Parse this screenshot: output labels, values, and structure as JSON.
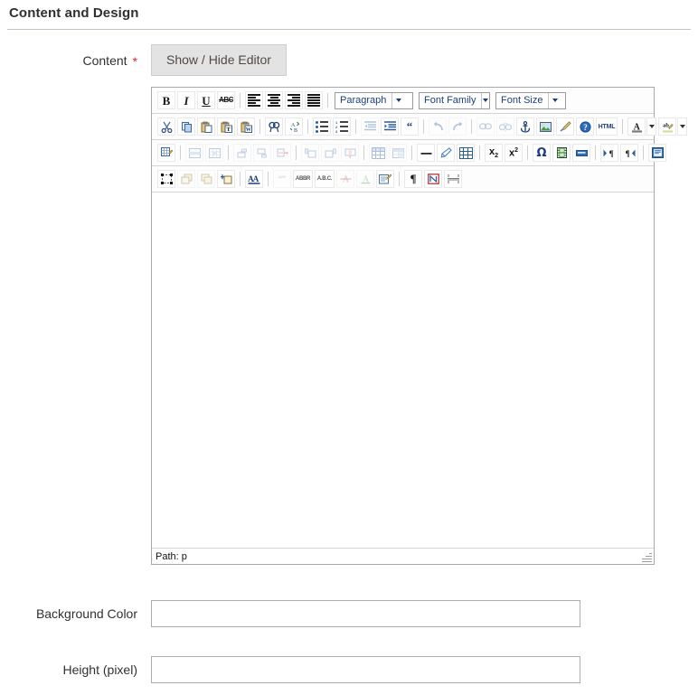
{
  "section": {
    "title": "Content and Design"
  },
  "fields": {
    "content": {
      "label": "Content",
      "required_marker": "*",
      "toggle_button": "Show / Hide Editor"
    },
    "background_color": {
      "label": "Background Color",
      "value": "",
      "placeholder": ""
    },
    "height_pixel": {
      "label": "Height (pixel)",
      "value": "",
      "placeholder": ""
    }
  },
  "editor": {
    "status_bar": "Path: p",
    "body_text": "",
    "selects": {
      "paragraph": "Paragraph",
      "font_family": "Font Family",
      "font_size": "Font Size"
    },
    "toolbar_rows": [
      {
        "name": "row-1",
        "items": [
          {
            "icon": "bold-icon",
            "label": "B"
          },
          {
            "icon": "italic-icon",
            "label": "I"
          },
          {
            "icon": "underline-icon",
            "label": "U"
          },
          {
            "icon": "strikethrough-icon",
            "label": "ABC"
          },
          {
            "icon": "separator"
          },
          {
            "icon": "align-left-icon",
            "label": ""
          },
          {
            "icon": "align-center-icon",
            "label": ""
          },
          {
            "icon": "align-right-icon",
            "label": ""
          },
          {
            "icon": "align-justify-icon",
            "label": ""
          },
          {
            "icon": "separator"
          },
          {
            "icon": "paragraph-format-select",
            "label": "Paragraph"
          },
          {
            "icon": "font-family-select",
            "label": "Font Family"
          },
          {
            "icon": "font-size-select",
            "label": "Font Size"
          }
        ]
      },
      {
        "name": "row-2",
        "items": [
          {
            "icon": "cut-icon",
            "label": ""
          },
          {
            "icon": "copy-icon",
            "label": ""
          },
          {
            "icon": "paste-icon",
            "label": ""
          },
          {
            "icon": "paste-as-text-icon",
            "label": ""
          },
          {
            "icon": "paste-from-word-icon",
            "label": ""
          },
          {
            "icon": "separator"
          },
          {
            "icon": "find-icon",
            "label": ""
          },
          {
            "icon": "find-replace-icon",
            "label": ""
          },
          {
            "icon": "separator"
          },
          {
            "icon": "bullet-list-icon",
            "label": ""
          },
          {
            "icon": "numbered-list-icon",
            "label": ""
          },
          {
            "icon": "separator"
          },
          {
            "icon": "outdent-icon",
            "label": ""
          },
          {
            "icon": "indent-icon",
            "label": ""
          },
          {
            "icon": "blockquote-icon",
            "label": ""
          },
          {
            "icon": "separator"
          },
          {
            "icon": "undo-icon",
            "label": ""
          },
          {
            "icon": "redo-icon",
            "label": ""
          },
          {
            "icon": "separator"
          },
          {
            "icon": "insert-link-icon",
            "label": ""
          },
          {
            "icon": "unlink-icon",
            "label": ""
          },
          {
            "icon": "anchor-icon",
            "label": ""
          },
          {
            "icon": "insert-image-icon",
            "label": ""
          },
          {
            "icon": "cleanup-icon",
            "label": ""
          },
          {
            "icon": "help-icon",
            "label": ""
          },
          {
            "icon": "html-source-icon",
            "label": "HTML"
          },
          {
            "icon": "separator"
          },
          {
            "icon": "text-color-icon",
            "label": "A"
          },
          {
            "icon": "text-color-dropdown-icon",
            "label": ""
          },
          {
            "icon": "background-color-icon",
            "label": "ab"
          },
          {
            "icon": "background-color-dropdown-icon",
            "label": ""
          }
        ]
      },
      {
        "name": "row-3",
        "items": [
          {
            "icon": "insert-table-icon",
            "label": ""
          },
          {
            "icon": "separator"
          },
          {
            "icon": "table-row-properties-icon",
            "label": ""
          },
          {
            "icon": "table-cell-properties-icon",
            "label": ""
          },
          {
            "icon": "separator"
          },
          {
            "icon": "insert-row-before-icon",
            "label": ""
          },
          {
            "icon": "insert-row-after-icon",
            "label": ""
          },
          {
            "icon": "delete-row-icon",
            "label": ""
          },
          {
            "icon": "separator"
          },
          {
            "icon": "insert-column-before-icon",
            "label": ""
          },
          {
            "icon": "insert-column-after-icon",
            "label": ""
          },
          {
            "icon": "delete-column-icon",
            "label": ""
          },
          {
            "icon": "separator"
          },
          {
            "icon": "split-cells-icon",
            "label": ""
          },
          {
            "icon": "merge-cells-icon",
            "label": ""
          },
          {
            "icon": "separator"
          },
          {
            "icon": "horizontal-rule-icon",
            "label": ""
          },
          {
            "icon": "remove-format-icon",
            "label": ""
          },
          {
            "icon": "toggle-guidelines-icon",
            "label": ""
          },
          {
            "icon": "separator"
          },
          {
            "icon": "subscript-icon",
            "label": ""
          },
          {
            "icon": "superscript-icon",
            "label": ""
          },
          {
            "icon": "separator"
          },
          {
            "icon": "special-character-icon",
            "label": ""
          },
          {
            "icon": "insert-media-icon",
            "label": ""
          },
          {
            "icon": "insert-page-break-icon",
            "label": ""
          },
          {
            "icon": "separator"
          },
          {
            "icon": "ltr-direction-icon",
            "label": ""
          },
          {
            "icon": "rtl-direction-icon",
            "label": ""
          },
          {
            "icon": "separator"
          },
          {
            "icon": "insert-layer-icon",
            "label": ""
          }
        ]
      },
      {
        "name": "row-4",
        "items": [
          {
            "icon": "select-layer-icon",
            "label": ""
          },
          {
            "icon": "move-forward-icon",
            "label": ""
          },
          {
            "icon": "move-backward-icon",
            "label": ""
          },
          {
            "icon": "absolute-position-icon",
            "label": ""
          },
          {
            "icon": "separator"
          },
          {
            "icon": "styleprops-icon",
            "label": ""
          },
          {
            "icon": "separator"
          },
          {
            "icon": "citation-icon",
            "label": ""
          },
          {
            "icon": "abbreviation-icon",
            "label": ""
          },
          {
            "icon": "acronym-icon",
            "label": ""
          },
          {
            "icon": "delete-text-icon",
            "label": ""
          },
          {
            "icon": "insert-text-icon",
            "label": ""
          },
          {
            "icon": "attributes-icon",
            "label": ""
          },
          {
            "icon": "separator"
          },
          {
            "icon": "show-blocks-icon",
            "label": ""
          },
          {
            "icon": "nonbreaking-icon",
            "label": ""
          },
          {
            "icon": "page-break-icon",
            "label": ""
          }
        ]
      }
    ]
  },
  "colors": {
    "divider": "#c9c2b9",
    "required": "#e02b27",
    "text": "#303030",
    "button_bg": "#e3e3e3",
    "button_border": "#cdcdcd",
    "input_border": "#adadad",
    "editor_border": "#a9a9a9"
  }
}
